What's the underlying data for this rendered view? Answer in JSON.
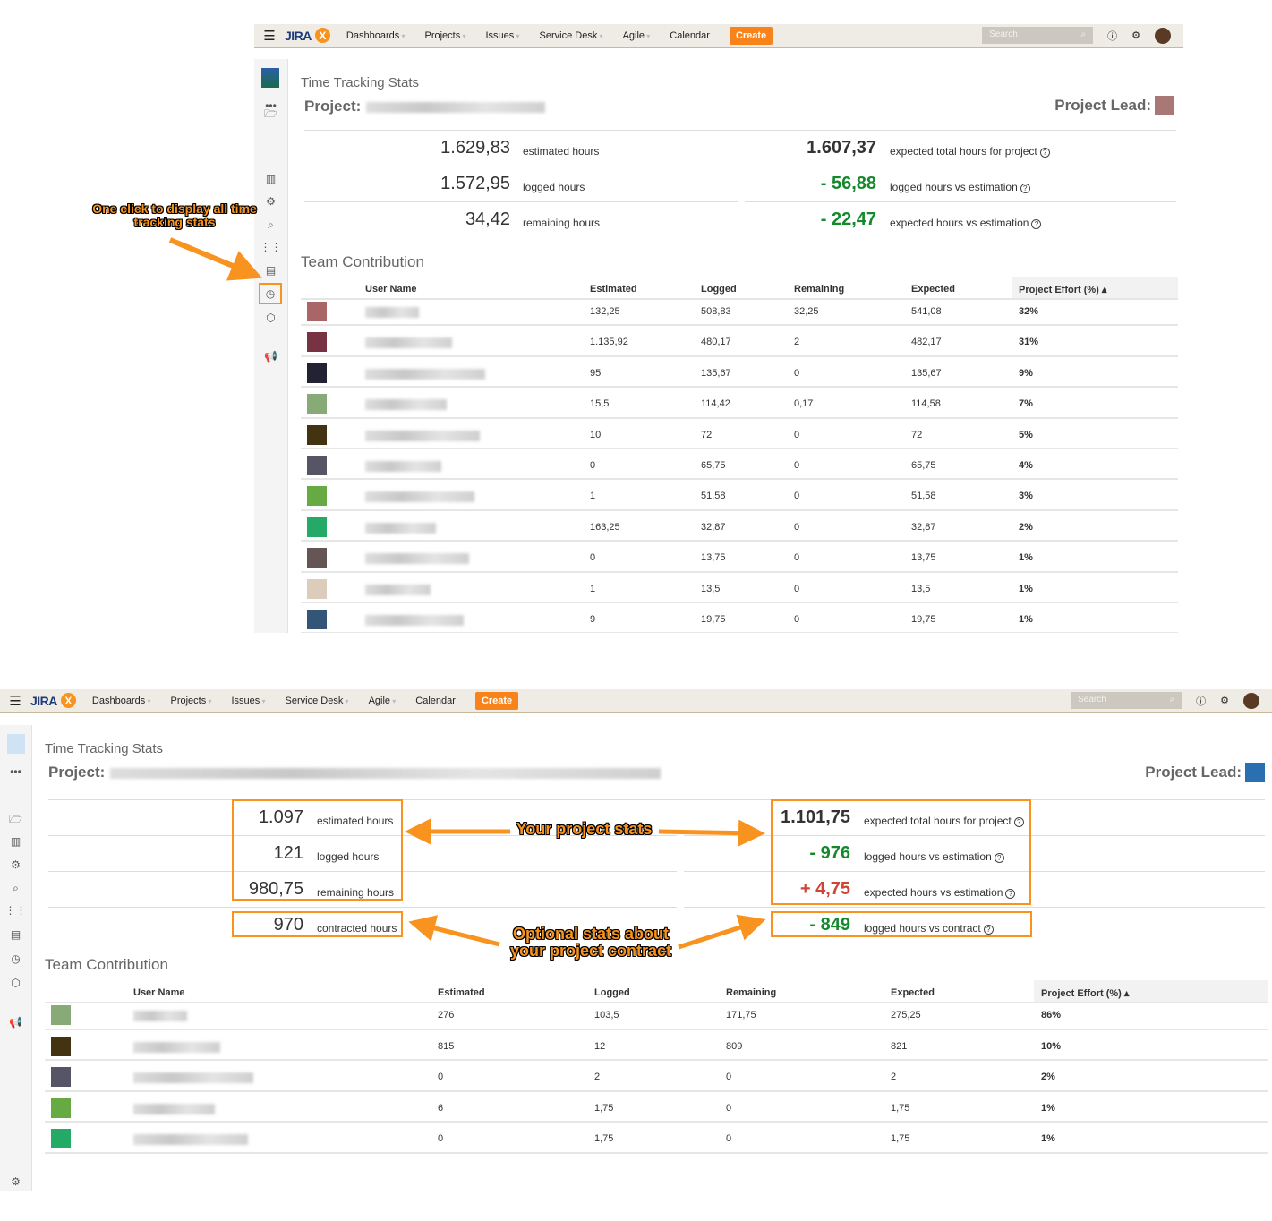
{
  "nav": {
    "logo": "JIRA",
    "badge": "X",
    "items": [
      {
        "label": "Dashboards",
        "dropdown": true
      },
      {
        "label": "Projects",
        "dropdown": true
      },
      {
        "label": "Issues",
        "dropdown": true
      },
      {
        "label": "Service Desk",
        "dropdown": true
      },
      {
        "label": "Agile",
        "dropdown": true
      },
      {
        "label": "Calendar",
        "dropdown": false
      }
    ],
    "create_label": "Create",
    "search_placeholder": "Search",
    "icons": [
      "menu-icon",
      "help-icon",
      "gear-icon",
      "user-avatar"
    ]
  },
  "colors": {
    "accent": "#f7931e",
    "green": "#14892c",
    "red": "#d04437",
    "nav_bg": "#efece6"
  },
  "annotations": {
    "one_click": "One click to display all time tracking stats",
    "project_stats": "Your project stats",
    "contract_stats": "Optional stats about your project contract"
  },
  "screens": [
    {
      "page_title": "Time Tracking Stats",
      "project_label": "Project:",
      "project_lead_label": "Project Lead:",
      "stats_left": [
        {
          "value": "1.629,83",
          "label": "estimated hours"
        },
        {
          "value": "1.572,95",
          "label": "logged hours"
        },
        {
          "value": "34,42",
          "label": "remaining hours"
        }
      ],
      "stats_right": [
        {
          "value": "1.607,37",
          "label": "expected total hours for project",
          "tone": "normal"
        },
        {
          "value": "- 56,88",
          "label": "logged hours vs estimation",
          "tone": "green"
        },
        {
          "value": "- 22,47",
          "label": "expected hours vs estimation",
          "tone": "green"
        }
      ],
      "team_title": "Team Contribution",
      "columns": [
        "User Name",
        "Estimated",
        "Logged",
        "Remaining",
        "Expected",
        "Project Effort (%) ▴"
      ],
      "rows": [
        [
          "132,25",
          "508,83",
          "32,25",
          "541,08",
          "32%"
        ],
        [
          "1.135,92",
          "480,17",
          "2",
          "482,17",
          "31%"
        ],
        [
          "95",
          "135,67",
          "0",
          "135,67",
          "9%"
        ],
        [
          "15,5",
          "114,42",
          "0,17",
          "114,58",
          "7%"
        ],
        [
          "10",
          "72",
          "0",
          "72",
          "5%"
        ],
        [
          "0",
          "65,75",
          "0",
          "65,75",
          "4%"
        ],
        [
          "1",
          "51,58",
          "0",
          "51,58",
          "3%"
        ],
        [
          "163,25",
          "32,87",
          "0",
          "32,87",
          "2%"
        ],
        [
          "0",
          "13,75",
          "0",
          "13,75",
          "1%"
        ],
        [
          "1",
          "13,5",
          "0",
          "13,5",
          "1%"
        ],
        [
          "9",
          "19,75",
          "0",
          "19,75",
          "1%"
        ]
      ]
    },
    {
      "page_title": "Time Tracking Stats",
      "project_label": "Project:",
      "project_lead_label": "Project Lead:",
      "stats_left": [
        {
          "value": "1.097",
          "label": "estimated hours"
        },
        {
          "value": "121",
          "label": "logged hours"
        },
        {
          "value": "980,75",
          "label": "remaining hours"
        },
        {
          "value": "970",
          "label": "contracted hours"
        }
      ],
      "stats_right": [
        {
          "value": "1.101,75",
          "label": "expected total hours for project",
          "tone": "normal"
        },
        {
          "value": "- 976",
          "label": "logged hours vs estimation",
          "tone": "green"
        },
        {
          "value": "+ 4,75",
          "label": "expected hours vs estimation",
          "tone": "red"
        },
        {
          "value": "- 849",
          "label": "logged hours vs contract",
          "tone": "green"
        }
      ],
      "team_title": "Team Contribution",
      "columns": [
        "User Name",
        "Estimated",
        "Logged",
        "Remaining",
        "Expected",
        "Project Effort (%) ▴"
      ],
      "rows": [
        [
          "276",
          "103,5",
          "171,75",
          "275,25",
          "86%"
        ],
        [
          "815",
          "12",
          "809",
          "821",
          "10%"
        ],
        [
          "0",
          "2",
          "0",
          "2",
          "2%"
        ],
        [
          "6",
          "1,75",
          "0",
          "1,75",
          "1%"
        ],
        [
          "0",
          "1,75",
          "0",
          "1,75",
          "1%"
        ]
      ]
    }
  ]
}
